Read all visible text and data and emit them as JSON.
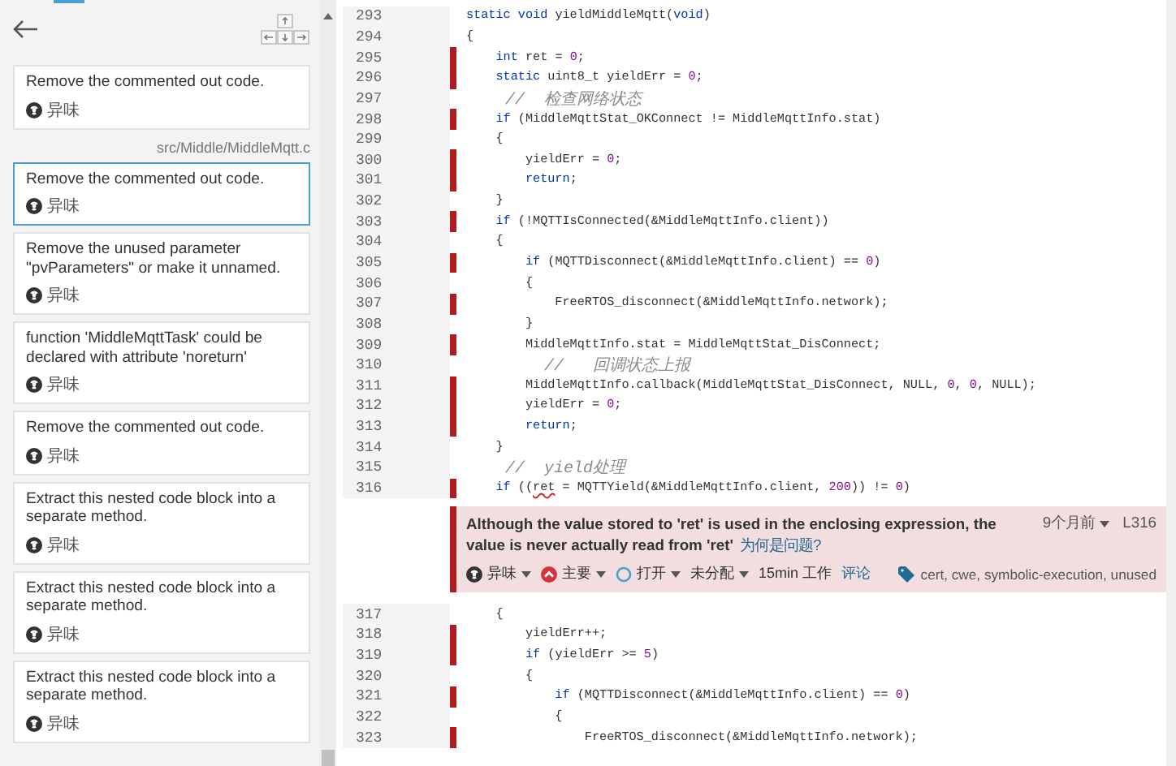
{
  "sidebar": {
    "file_path": "src/Middle/MiddleMqtt.c",
    "issues_before": [
      {
        "message": "Remove the commented out code.",
        "type": "异味",
        "selected": false
      }
    ],
    "issues": [
      {
        "message": "Remove the commented out code.",
        "type": "异味",
        "selected": true
      },
      {
        "message": "Remove the unused parameter \"pvParameters\" or make it unnamed.",
        "type": "异味",
        "selected": false
      },
      {
        "message": "function 'MiddleMqttTask' could be declared with attribute 'noreturn'",
        "type": "异味",
        "selected": false
      },
      {
        "message": "Remove the commented out code.",
        "type": "异味",
        "selected": false
      },
      {
        "message": "Extract this nested code block into a separate method.",
        "type": "异味",
        "selected": false
      },
      {
        "message": "Extract this nested code block into a separate method.",
        "type": "异味",
        "selected": false
      },
      {
        "message": "Extract this nested code block into a separate method.",
        "type": "异味",
        "selected": false
      }
    ]
  },
  "code_before": [
    {
      "number": "293",
      "marked": false,
      "tokens": [
        {
          "kind": "keyword",
          "t": "static void"
        },
        {
          "kind": "plain",
          "t": " yieldMiddleMqtt("
        },
        {
          "kind": "keyword",
          "t": "void"
        },
        {
          "kind": "plain",
          "t": ")"
        }
      ]
    },
    {
      "number": "294",
      "marked": false,
      "tokens": [
        {
          "kind": "plain",
          "t": "{"
        }
      ]
    },
    {
      "number": "295",
      "marked": true,
      "tokens": [
        {
          "kind": "keyword",
          "t": "    int"
        },
        {
          "kind": "plain",
          "t": " ret = "
        },
        {
          "kind": "number",
          "t": "0"
        },
        {
          "kind": "plain",
          "t": ";"
        }
      ]
    },
    {
      "number": "296",
      "marked": true,
      "tokens": [
        {
          "kind": "keyword",
          "t": "    static"
        },
        {
          "kind": "plain",
          "t": " uint8_t yieldErr = "
        },
        {
          "kind": "number",
          "t": "0"
        },
        {
          "kind": "plain",
          "t": ";"
        }
      ]
    },
    {
      "number": "297",
      "marked": false,
      "tokens": [
        {
          "kind": "comment",
          "t": "    //  检查网络状态"
        }
      ]
    },
    {
      "number": "298",
      "marked": true,
      "tokens": [
        {
          "kind": "keyword",
          "t": "    if"
        },
        {
          "kind": "plain",
          "t": " (MiddleMqttStat_OKConnect != MiddleMqttInfo.stat)"
        }
      ]
    },
    {
      "number": "299",
      "marked": false,
      "tokens": [
        {
          "kind": "plain",
          "t": "    {"
        }
      ]
    },
    {
      "number": "300",
      "marked": true,
      "tokens": [
        {
          "kind": "plain",
          "t": "        yieldErr = "
        },
        {
          "kind": "number",
          "t": "0"
        },
        {
          "kind": "plain",
          "t": ";"
        }
      ]
    },
    {
      "number": "301",
      "marked": true,
      "tokens": [
        {
          "kind": "keyword",
          "t": "        return"
        },
        {
          "kind": "plain",
          "t": ";"
        }
      ]
    },
    {
      "number": "302",
      "marked": false,
      "tokens": [
        {
          "kind": "plain",
          "t": "    }"
        }
      ]
    },
    {
      "number": "303",
      "marked": true,
      "tokens": [
        {
          "kind": "keyword",
          "t": "    if"
        },
        {
          "kind": "plain",
          "t": " (!MQTTIsConnected(&MiddleMqttInfo.client))"
        }
      ]
    },
    {
      "number": "304",
      "marked": false,
      "tokens": [
        {
          "kind": "plain",
          "t": "    {"
        }
      ]
    },
    {
      "number": "305",
      "marked": true,
      "tokens": [
        {
          "kind": "keyword",
          "t": "        if"
        },
        {
          "kind": "plain",
          "t": " (MQTTDisconnect(&MiddleMqttInfo.client) == "
        },
        {
          "kind": "number",
          "t": "0"
        },
        {
          "kind": "plain",
          "t": ")"
        }
      ]
    },
    {
      "number": "306",
      "marked": false,
      "tokens": [
        {
          "kind": "plain",
          "t": "        {"
        }
      ]
    },
    {
      "number": "307",
      "marked": true,
      "tokens": [
        {
          "kind": "plain",
          "t": "            FreeRTOS_disconnect(&MiddleMqttInfo.network);"
        }
      ]
    },
    {
      "number": "308",
      "marked": false,
      "tokens": [
        {
          "kind": "plain",
          "t": "        }"
        }
      ]
    },
    {
      "number": "309",
      "marked": true,
      "tokens": [
        {
          "kind": "plain",
          "t": "        MiddleMqttInfo.stat = MiddleMqttStat_DisConnect;"
        }
      ]
    },
    {
      "number": "310",
      "marked": false,
      "tokens": [
        {
          "kind": "comment",
          "t": "        //   回调状态上报"
        }
      ]
    },
    {
      "number": "311",
      "marked": true,
      "tokens": [
        {
          "kind": "plain",
          "t": "        MiddleMqttInfo.callback(MiddleMqttStat_DisConnect, NULL, "
        },
        {
          "kind": "number",
          "t": "0"
        },
        {
          "kind": "plain",
          "t": ", "
        },
        {
          "kind": "number",
          "t": "0"
        },
        {
          "kind": "plain",
          "t": ", NULL);"
        }
      ]
    },
    {
      "number": "312",
      "marked": true,
      "tokens": [
        {
          "kind": "plain",
          "t": "        yieldErr = "
        },
        {
          "kind": "number",
          "t": "0"
        },
        {
          "kind": "plain",
          "t": ";"
        }
      ]
    },
    {
      "number": "313",
      "marked": true,
      "tokens": [
        {
          "kind": "keyword",
          "t": "        return"
        },
        {
          "kind": "plain",
          "t": ";"
        }
      ]
    },
    {
      "number": "314",
      "marked": false,
      "tokens": [
        {
          "kind": "plain",
          "t": "    }"
        }
      ]
    },
    {
      "number": "315",
      "marked": false,
      "tokens": [
        {
          "kind": "comment",
          "t": "    //  yield处理"
        }
      ]
    },
    {
      "number": "316",
      "marked": true,
      "tokens": [
        {
          "kind": "keyword",
          "t": "    if"
        },
        {
          "kind": "plain",
          "t": " (("
        },
        {
          "kind": "flagged",
          "t": "ret"
        },
        {
          "kind": "plain",
          "t": " = MQTTYield(&MiddleMqttInfo.client, "
        },
        {
          "kind": "number",
          "t": "200"
        },
        {
          "kind": "plain",
          "t": ")) != "
        },
        {
          "kind": "number",
          "t": "0"
        },
        {
          "kind": "plain",
          "t": ")"
        }
      ]
    }
  ],
  "issue": {
    "message": "Although the value stored to 'ret' is used in the enclosing expression, the value is never actually read from 'ret'",
    "why_link": "为何是问题?",
    "age": "9个月前",
    "line": "L316",
    "type": "异味",
    "severity": "主要",
    "status": "打开",
    "assignee": "未分配",
    "effort": "15min 工作",
    "comment": "评论",
    "tags": "cert, cwe, symbolic-execution, unused"
  },
  "code_after": [
    {
      "number": "317",
      "marked": false,
      "tokens": [
        {
          "kind": "plain",
          "t": "    {"
        }
      ]
    },
    {
      "number": "318",
      "marked": true,
      "tokens": [
        {
          "kind": "plain",
          "t": "        yieldErr++;"
        }
      ]
    },
    {
      "number": "319",
      "marked": true,
      "tokens": [
        {
          "kind": "keyword",
          "t": "        if"
        },
        {
          "kind": "plain",
          "t": " (yieldErr >= "
        },
        {
          "kind": "number",
          "t": "5"
        },
        {
          "kind": "plain",
          "t": ")"
        }
      ]
    },
    {
      "number": "320",
      "marked": false,
      "tokens": [
        {
          "kind": "plain",
          "t": "        {"
        }
      ]
    },
    {
      "number": "321",
      "marked": true,
      "tokens": [
        {
          "kind": "keyword",
          "t": "            if"
        },
        {
          "kind": "plain",
          "t": " (MQTTDisconnect(&MiddleMqttInfo.client) == "
        },
        {
          "kind": "number",
          "t": "0"
        },
        {
          "kind": "plain",
          "t": ")"
        }
      ]
    },
    {
      "number": "322",
      "marked": false,
      "tokens": [
        {
          "kind": "plain",
          "t": "            {"
        }
      ]
    },
    {
      "number": "323",
      "marked": true,
      "tokens": [
        {
          "kind": "plain",
          "t": "                FreeRTOS_disconnect(&MiddleMqttInfo.network);"
        }
      ]
    }
  ]
}
